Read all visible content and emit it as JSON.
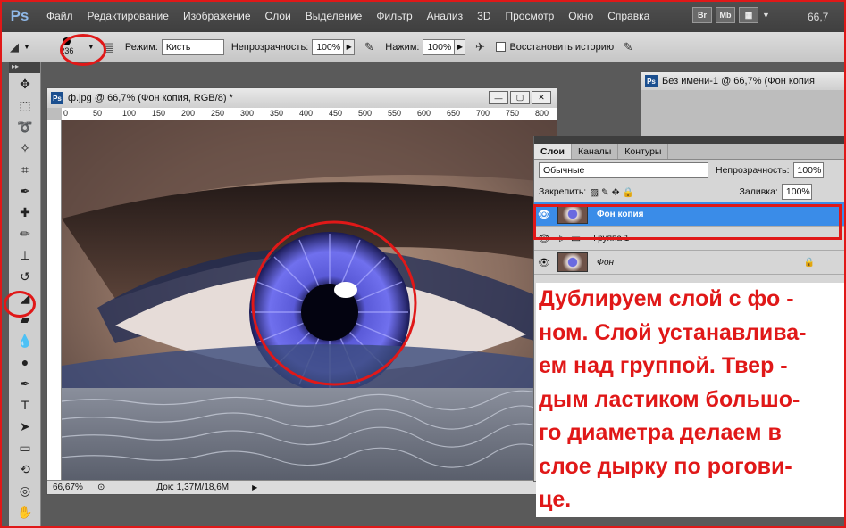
{
  "menu": {
    "logo": "Ps",
    "items": [
      "Файл",
      "Редактирование",
      "Изображение",
      "Слои",
      "Выделение",
      "Фильтр",
      "Анализ",
      "3D",
      "Просмотр",
      "Окно",
      "Справка"
    ],
    "right_buttons": [
      "Br",
      "Mb"
    ],
    "zoom": "66,7"
  },
  "options": {
    "brush_size": "236",
    "mode_label": "Режим:",
    "mode_value": "Кисть",
    "opacity_label": "Непрозрачность:",
    "opacity_value": "100%",
    "flow_label": "Нажим:",
    "flow_value": "100%",
    "history_label": "Восстановить историю"
  },
  "document": {
    "badge": "Ps",
    "title": "ф.jpg @ 66,7% (Фон копия, RGB/8) *",
    "ruler_top": [
      "0",
      "50",
      "100",
      "150",
      "200",
      "250",
      "300",
      "350",
      "400",
      "450",
      "500",
      "550",
      "600",
      "650",
      "700",
      "750",
      "800"
    ],
    "zoom": "66,67%",
    "doc_info": "Док: 1,37M/18,6M"
  },
  "document2": {
    "title": "Без имени-1 @ 66,7% (Фон копия"
  },
  "layers_panel": {
    "tabs": [
      "Слои",
      "Каналы",
      "Контуры"
    ],
    "blend_mode": "Обычные",
    "opacity_label": "Непрозрачность:",
    "opacity_value": "100%",
    "lock_label": "Закрепить:",
    "fill_label": "Заливка:",
    "fill_value": "100%",
    "layers": [
      {
        "name": "Фон копия",
        "selected": true
      },
      {
        "name": "Группа 1",
        "selected": false
      },
      {
        "name": "Фон",
        "selected": false
      }
    ]
  },
  "instructions": [
    "Дублируем слой с фо -",
    "ном. Слой устанавлива-",
    "ем над группой. Твер -",
    "дым ластиком большо-",
    "го диаметра делаем в",
    " слое дырку по рогови-",
    " це."
  ],
  "colors": {
    "highlight": "#e01818",
    "selected_layer": "#3a8ce8"
  }
}
